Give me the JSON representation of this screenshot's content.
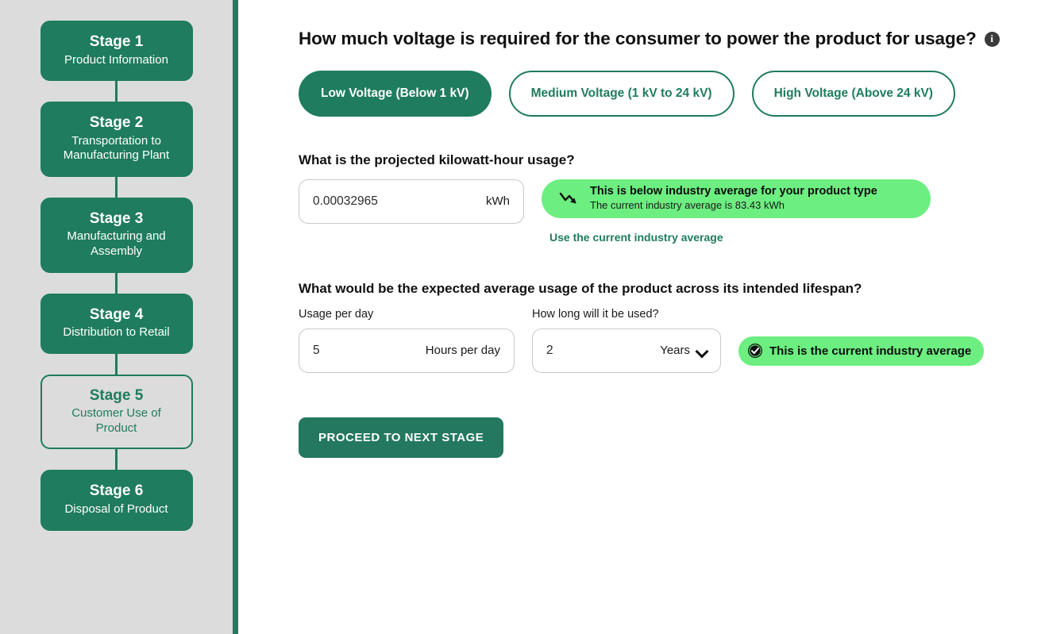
{
  "sidebar": {
    "stages": [
      {
        "title": "Stage 1",
        "subtitle": "Product Information",
        "active": false
      },
      {
        "title": "Stage 2",
        "subtitle": "Transportation to Manufacturing Plant",
        "active": false
      },
      {
        "title": "Stage 3",
        "subtitle": "Manufacturing and Assembly",
        "active": false
      },
      {
        "title": "Stage 4",
        "subtitle": "Distribution to Retail",
        "active": false
      },
      {
        "title": "Stage 5",
        "subtitle": "Customer Use of Product",
        "active": true
      },
      {
        "title": "Stage 6",
        "subtitle": "Disposal of Product",
        "active": false
      }
    ]
  },
  "main": {
    "page_title": "How much voltage is required for the consumer to power the product for usage?",
    "info_icon": "info-icon",
    "voltage": {
      "options": [
        {
          "label": "Low Voltage (Below 1 kV)",
          "selected": true
        },
        {
          "label": "Medium Voltage (1 kV to 24 kV)",
          "selected": false
        },
        {
          "label": "High Voltage (Above 24 kV)",
          "selected": false
        }
      ]
    },
    "kwh_section": {
      "question": "What is the projected kilowatt-hour usage?",
      "input_value": "0.00032965",
      "input_unit": "kWh",
      "badge_icon": "trending-down-icon",
      "badge_main": "This is below industry average for your product type",
      "badge_sub": "The current industry average is 83.43 kWh",
      "link_label": "Use the current industry average"
    },
    "usage_section": {
      "question": "What would be the expected average usage of the product across its intended lifespan?",
      "per_day_label": "Usage per day",
      "per_day_value": "5",
      "per_day_unit": "Hours per day",
      "duration_label": "How long will it be used?",
      "duration_value": "2",
      "duration_unit": "Years",
      "duration_options": [
        "Years"
      ],
      "badge_icon": "check-circle-icon",
      "badge_main": "This is the current industry average"
    },
    "proceed_label": "PROCEED TO NEXT STAGE"
  },
  "colors": {
    "brand_green": "#1f7c5e",
    "badge_green": "#6cee80",
    "sidebar_gray": "#dcdcdc"
  }
}
